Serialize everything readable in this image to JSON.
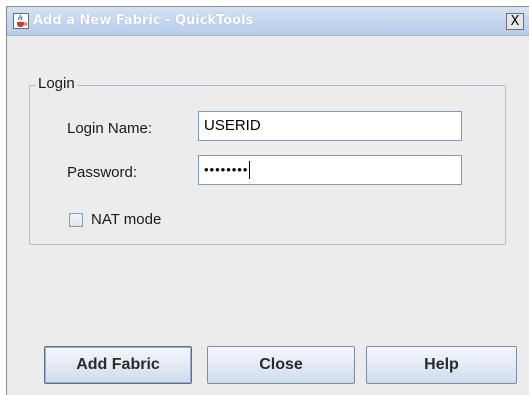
{
  "window": {
    "title": "Add a New Fabric - QuickTools",
    "close_glyph": "X"
  },
  "login_group": {
    "title": "Login",
    "login_name_label": "Login Name:",
    "login_name_value": "USERID",
    "password_label": "Password:",
    "password_value": "••••••••",
    "nat_mode_label": "NAT mode",
    "nat_mode_checked": false
  },
  "buttons": {
    "add_fabric": "Add Fabric",
    "close": "Close",
    "help": "Help"
  },
  "icons": {
    "app": "java-cup-icon",
    "close": "close-icon"
  },
  "colors": {
    "titlebar": "#c2d5ee",
    "dialog_bg": "#ececec",
    "field_border": "#7f9db9"
  }
}
